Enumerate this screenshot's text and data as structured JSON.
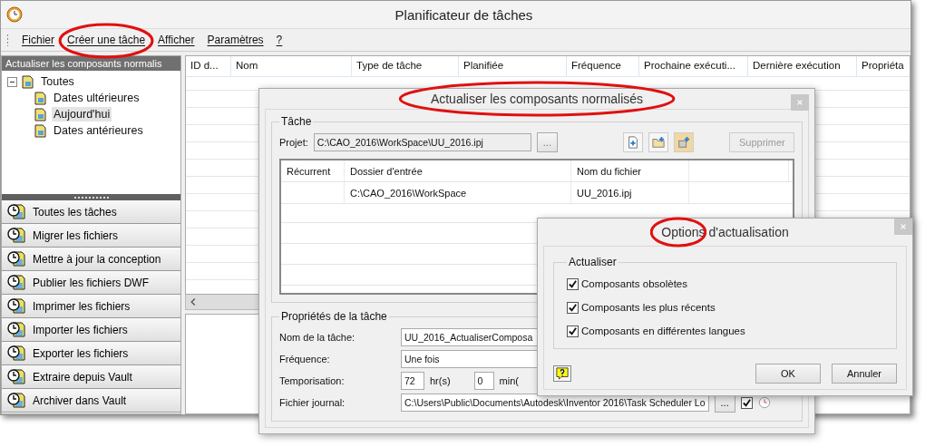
{
  "window": {
    "title": "Planificateur de tâches"
  },
  "menu": [
    "Fichier",
    "Créer une tâche",
    "Afficher",
    "Paramètres",
    "?"
  ],
  "sidebar": {
    "header": "Actualiser les composants normalis",
    "tree": [
      {
        "label": "Toutes",
        "expanded": true,
        "selected": false,
        "children": [
          {
            "label": "Dates ultérieures",
            "selected": false
          },
          {
            "label": "Aujourd'hui",
            "selected": true
          },
          {
            "label": "Dates antérieures",
            "selected": false
          }
        ]
      }
    ],
    "nav": [
      "Toutes les tâches",
      "Migrer les fichiers",
      "Mettre à jour la conception",
      "Publier les fichiers DWF",
      "Imprimer les fichiers",
      "Importer les fichiers",
      "Exporter les fichiers",
      "Extraire depuis Vault",
      "Archiver dans Vault"
    ]
  },
  "task_table": {
    "columns": [
      "ID d...",
      "Nom",
      "Type de tâche",
      "Planifiée",
      "Fréquence",
      "Prochaine exécuti...",
      "Dernière exécution",
      "Propriéta"
    ]
  },
  "task_dialog": {
    "title": "Actualiser les composants normalisés",
    "group": "Tâche",
    "project_label": "Projet:",
    "project": "C:\\CAO_2016\\WorkSpace\\UU_2016.ipj",
    "browse": "...",
    "delete": "Supprimer",
    "delete_disabled": true,
    "files": {
      "columns": [
        "Récurrent",
        "Dossier d'entrée",
        "Nom du fichier"
      ],
      "rows": [
        {
          "input_folder": "C:\\CAO_2016\\WorkSpace",
          "file_name": "UU_2016.ipj"
        }
      ]
    },
    "properties": {
      "title": "Propriétés de la tâche",
      "fields": [
        {
          "kind": "text",
          "label": "Nom de la tâche:",
          "value": "UU_2016_ActualiserComposa"
        },
        {
          "kind": "select",
          "label": "Fréquence:",
          "value": "Une fois"
        },
        {
          "kind": "delay",
          "label": "Temporisation:",
          "hours": "72",
          "hours_unit": "hr(s)",
          "minutes": "0",
          "minutes_unit": "min("
        },
        {
          "kind": "file",
          "label": "Fichier journal:",
          "value": "C:\\Users\\Public\\Documents\\Autodesk\\Inventor 2016\\Task Scheduler Lo",
          "browse": "...",
          "checked": true
        }
      ]
    }
  },
  "options_dialog": {
    "title": "Options d'actualisation",
    "group": "Actualiser",
    "options": [
      {
        "label": "Composants obsolètes",
        "checked": true
      },
      {
        "label": "Composants les plus récents",
        "checked": true
      },
      {
        "label": "Composants en différentes langues",
        "checked": true
      }
    ],
    "buttons": [
      "OK",
      "Annuler"
    ]
  }
}
